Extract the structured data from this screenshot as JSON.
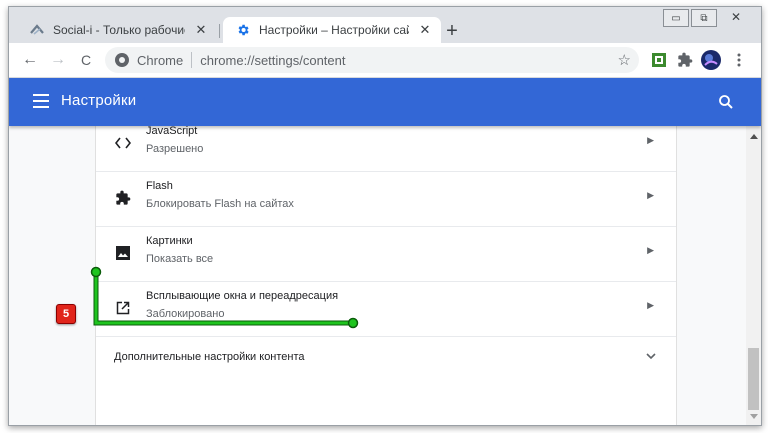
{
  "tabs": [
    {
      "title": "Social-i - Только рабочие инстр",
      "close": "✕",
      "active": false
    },
    {
      "title": "Настройки – Настройки сайтов",
      "close": "✕",
      "active": true
    }
  ],
  "new_tab": "+",
  "window_controls": {
    "minimize": "▭",
    "restore": "⧉",
    "close": "✕"
  },
  "toolbar": {
    "back": "←",
    "forward": "→",
    "reload": "C",
    "omnibox": {
      "host": "Chrome",
      "scheme": "chrome://",
      "path": "settings/content"
    },
    "bookmark_star": "☆"
  },
  "appbar": {
    "title": "Настройки"
  },
  "rows": [
    {
      "icon": "code-icon",
      "primary": "JavaScript",
      "secondary": "Разрешено"
    },
    {
      "icon": "puzzle-icon",
      "primary": "Flash",
      "secondary": "Блокировать Flash на сайтах"
    },
    {
      "icon": "image-icon",
      "primary": "Картинки",
      "secondary": "Показать все"
    },
    {
      "icon": "open-in-new-icon",
      "primary": "Всплывающие окна и переадресация",
      "secondary": "Заблокировано"
    }
  ],
  "arrow_glyph": "▶",
  "advanced": {
    "label": "Дополнительные настройки контента"
  },
  "annotation": {
    "badge": "5",
    "color": "#1ec41e"
  },
  "colors": {
    "accent": "#3367d6",
    "badge": "#e1251b"
  }
}
